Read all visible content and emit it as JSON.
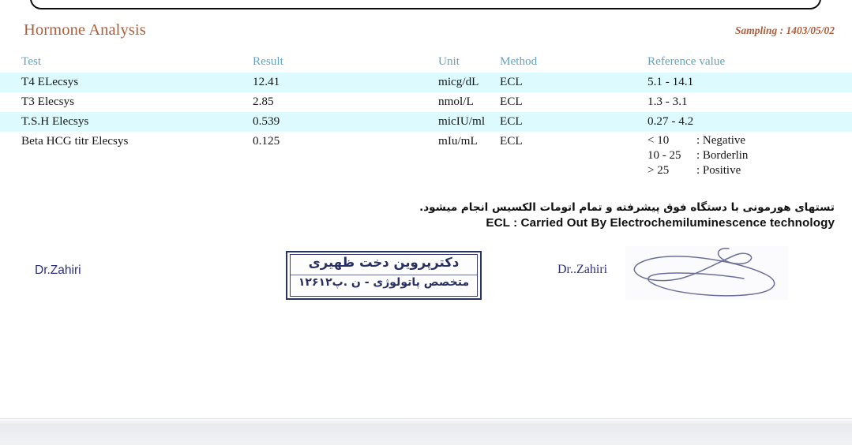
{
  "panel": {
    "title": "Hormone Analysis",
    "sampling_label": "Sampling : 1403/05/02"
  },
  "table": {
    "columns": {
      "test": "Test",
      "result": "Result",
      "unit": "Unit",
      "method": "Method",
      "reference": "Reference value"
    },
    "rows": [
      {
        "test": "T4 ELecsys",
        "result": "12.41",
        "unit": "micg/dL",
        "method": "ECL",
        "reference": "5.1 - 14.1"
      },
      {
        "test": "T3 Elecsys",
        "result": "2.85",
        "unit": "nmol/L",
        "method": "ECL",
        "reference": "1.3 - 3.1"
      },
      {
        "test": "T.S.H Elecsys",
        "result": "0.539",
        "unit": "micIU/ml",
        "method": "ECL",
        "reference": "0.27 - 4.2"
      },
      {
        "test": "Beta HCG titr Elecsys",
        "result": "0.125",
        "unit": "mIu/mL",
        "method": "ECL",
        "reference_lines": [
          {
            "range": "< 10",
            "verdict": ": Negative"
          },
          {
            "range": "10 - 25",
            "verdict": ": Borderlin"
          },
          {
            "range": "> 25",
            "verdict": ": Positive"
          }
        ]
      }
    ]
  },
  "notes": {
    "persian": "تستهای هورمونی با دستگاه فوق پیشرفته و تمام اتومات الکسیس انجام میشود.",
    "english": "ECL : Carried Out By Electrochemiluminescence technology"
  },
  "signature": {
    "left_name": "Dr.Zahiri",
    "right_name": "Dr..Zahiri",
    "stamp_line1": "دکترپروین دخت ظهیری",
    "stamp_line2": "متخصص پاتولوژی - ن .پ۱۲۶۱۲"
  },
  "colors": {
    "title": "#a9603e",
    "header": "#62a4c0",
    "zebra": "#ddfbff",
    "signature_ink": "#2b2f77"
  }
}
